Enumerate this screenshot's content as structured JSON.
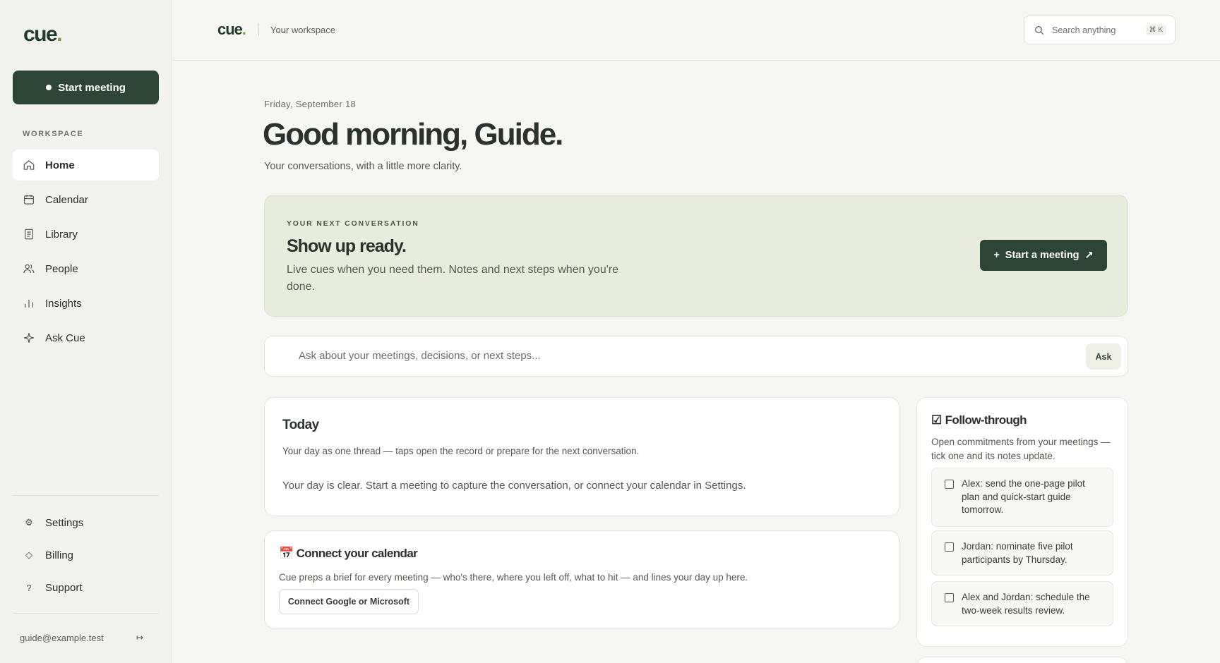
{
  "sidebar": {
    "logo": "cue",
    "logo_dot": ".",
    "start_button": "Start meeting",
    "section_label": "WORKSPACE",
    "nav": [
      {
        "label": "Home",
        "icon": "home-icon",
        "active": true
      },
      {
        "label": "Calendar",
        "icon": "calendar-icon"
      },
      {
        "label": "Library",
        "icon": "document-icon"
      },
      {
        "label": "People",
        "icon": "people-icon"
      },
      {
        "label": "Insights",
        "icon": "bar-chart-icon"
      },
      {
        "label": "Ask Cue",
        "icon": "sparkle-icon"
      }
    ],
    "bottom": [
      {
        "label": "Settings",
        "icon": "gear-icon",
        "glyph": "⚙"
      },
      {
        "label": "Billing",
        "icon": "diamond-icon",
        "glyph": "◇"
      },
      {
        "label": "Support",
        "icon": "question-icon",
        "glyph": "?"
      }
    ],
    "user_email": "guide@example.test",
    "logout_glyph": "↦"
  },
  "topbar": {
    "logo": "cue",
    "logo_dot": ".",
    "workspace": "Your workspace",
    "search_placeholder": "Search anything",
    "search_shortcut": "⌘ K"
  },
  "main": {
    "date": "Friday, September 18",
    "greeting": "Good morning, Guide.",
    "subtitle": "Your conversations, with a little more clarity.",
    "hero": {
      "label": "YOUR NEXT CONVERSATION",
      "title": "Show up ready.",
      "description": "Live cues when you need them. Notes and next steps when you're done.",
      "button": "Start a meeting",
      "button_plus": "+",
      "button_arrow": "↗"
    },
    "ask": {
      "placeholder": "Ask about your meetings, decisions, or next steps...",
      "button": "Ask"
    },
    "today": {
      "title": "Today",
      "subtitle": "Your day as one thread — taps open the record or prepare for the next conversation.",
      "empty": "Your day is clear. Start a meeting to capture the conversation, or connect your calendar in Settings."
    },
    "calendar": {
      "emoji": "📅",
      "title": "Connect your calendar",
      "subtitle": "Cue preps a brief for every meeting — who's there, where you left off, what to hit — and lines your day up here.",
      "button": "Connect Google or Microsoft"
    },
    "follow": {
      "glyph": "☑",
      "title": "Follow-through",
      "subtitle": "Open commitments from your meetings — tick one and its notes update.",
      "tasks": [
        {
          "text": "Alex: send the one-page pilot plan and quick-start guide tomorrow.",
          "done": false
        },
        {
          "text": "Jordan: nominate five pilot participants by Thursday.",
          "done": false
        },
        {
          "text": "Alex and Jordan: schedule the two-week results review.",
          "done": false
        }
      ]
    }
  },
  "colors": {
    "brand_dark": "#2c4537",
    "brand_dot": "#7f9a3a",
    "hero_bg": "#e8ecdd",
    "page_bg": "#f6f6f3"
  }
}
